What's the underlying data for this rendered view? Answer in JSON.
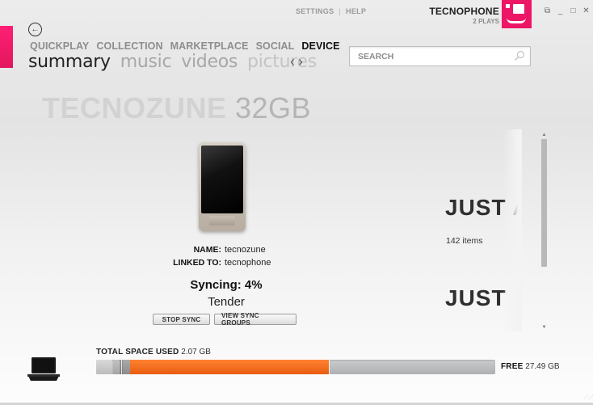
{
  "header": {
    "links": {
      "settings": "SETTINGS",
      "separator": "|",
      "help": "HELP"
    },
    "account": {
      "name": "TECNOPHONE",
      "plays": "2 PLAYS"
    },
    "window_controls": {
      "restore": "⧉",
      "minimize": "_",
      "maximize": "□",
      "close": "✕"
    }
  },
  "nav": {
    "back_glyph": "←",
    "items": [
      {
        "label": "QUICKPLAY"
      },
      {
        "label": "COLLECTION"
      },
      {
        "label": "MARKETPLACE"
      },
      {
        "label": "SOCIAL"
      },
      {
        "label": "DEVICE",
        "active": true
      }
    ],
    "subnav": [
      {
        "label": "summary",
        "active": true
      },
      {
        "label": "music"
      },
      {
        "label": "videos"
      },
      {
        "label": "pictures"
      }
    ],
    "prev_glyph": "‹",
    "next_glyph": "›"
  },
  "search": {
    "placeholder": "SEARCH",
    "value": ""
  },
  "device": {
    "name_bold": "TECNOZUNE",
    "capacity": "32GB",
    "info": {
      "name_label": "NAME:",
      "name_value": "tecnozune",
      "linked_label": "LINKED TO:",
      "linked_value": "tecnophone"
    },
    "sync_status": "Syncing: 4%",
    "sync_progress": 0.04,
    "current_item": "Tender",
    "buttons": {
      "stop_sync": "STOP SYNC",
      "view_sync_groups": "VIEW SYNC GROUPS"
    }
  },
  "right_panel": {
    "heading1": "JUST A",
    "subtext": "142 items",
    "heading2": "JUST"
  },
  "storage": {
    "total_label": "TOTAL SPACE USED",
    "total_value": "2.07 GB",
    "free_label": "FREE",
    "free_value": "27.49 GB"
  },
  "colors": {
    "accent": "#ec1566",
    "storage_used_orange": "#f07020",
    "storage_free_gray": "#b0b3b5"
  }
}
